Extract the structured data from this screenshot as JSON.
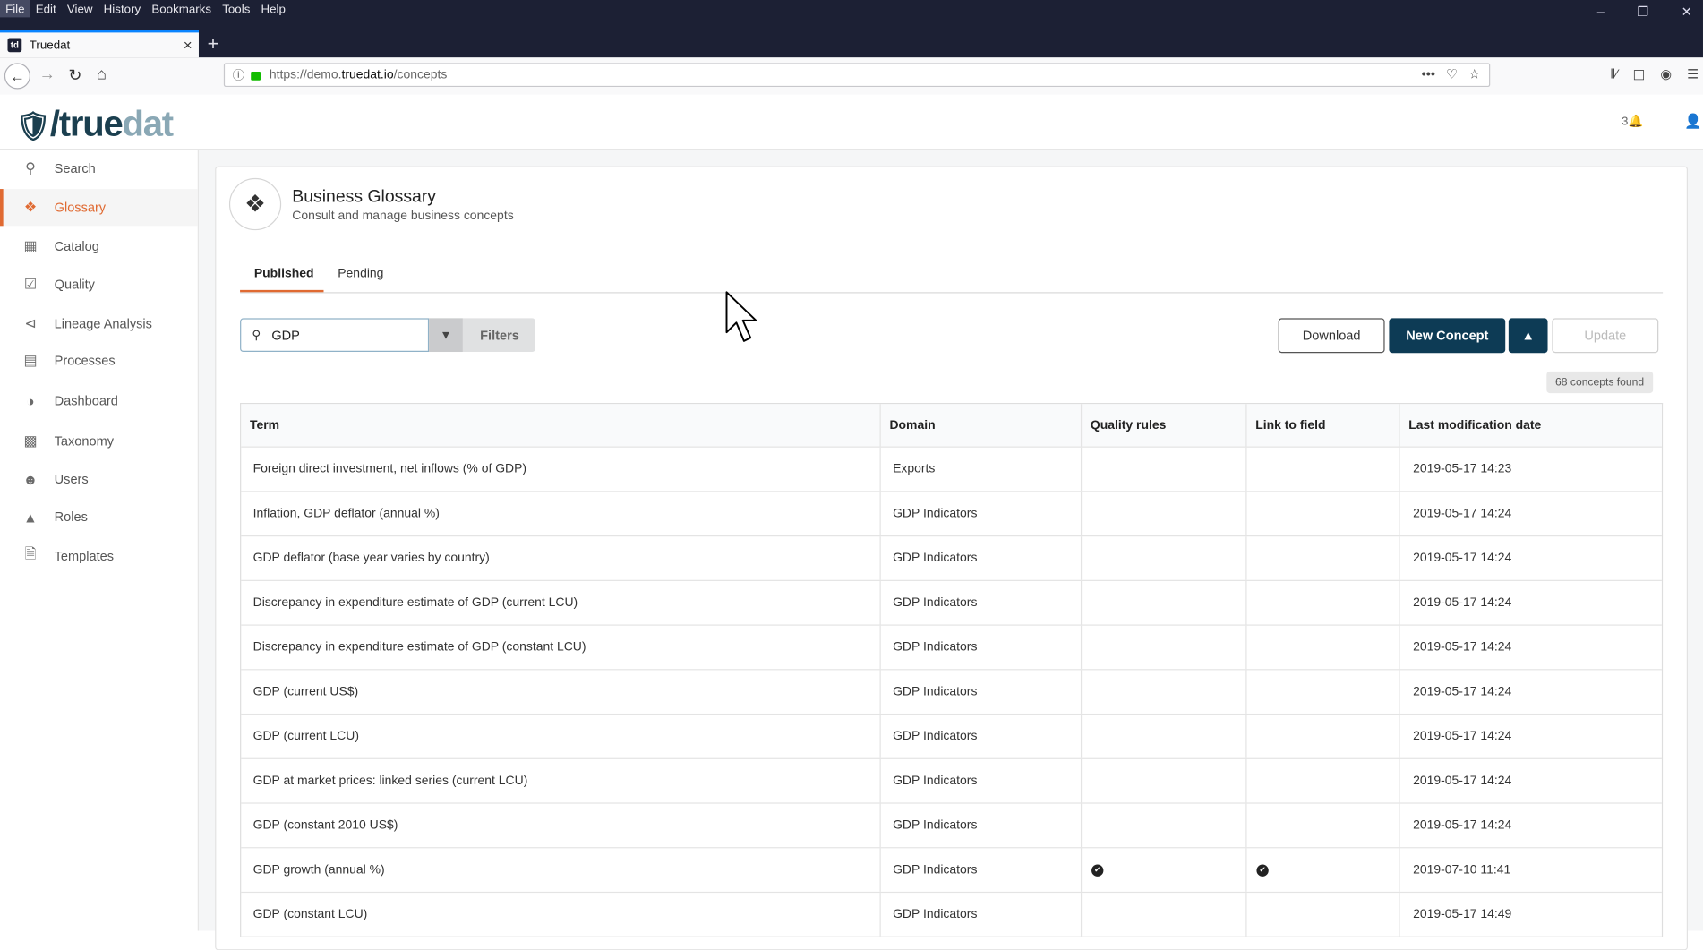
{
  "browser": {
    "menu": [
      "File",
      "Edit",
      "View",
      "History",
      "Bookmarks",
      "Tools",
      "Help"
    ],
    "tab_title": "Truedat",
    "favicon_text": "td",
    "url_prefix": "https://demo.",
    "url_domain": "truedat.io",
    "url_path": "/concepts"
  },
  "app": {
    "logo_main": "/true",
    "logo_accent": "dat",
    "notifications": "3"
  },
  "sidebar": {
    "items": [
      {
        "label": "Search",
        "icon": "search-icon"
      },
      {
        "label": "Glossary",
        "icon": "tags-icon"
      },
      {
        "label": "Catalog",
        "icon": "grid-icon"
      },
      {
        "label": "Quality",
        "icon": "checkbox-icon"
      },
      {
        "label": "Lineage Analysis",
        "icon": "share-icon"
      },
      {
        "label": "Processes",
        "icon": "drive-icon"
      },
      {
        "label": "Dashboard",
        "icon": "gauge-icon"
      },
      {
        "label": "Taxonomy",
        "icon": "sitemap-icon"
      },
      {
        "label": "Users",
        "icon": "users-icon"
      },
      {
        "label": "Roles",
        "icon": "graduation-icon"
      },
      {
        "label": "Templates",
        "icon": "file-code-icon"
      }
    ]
  },
  "page": {
    "title": "Business Glossary",
    "subtitle": "Consult and manage business concepts",
    "tabs": [
      "Published",
      "Pending"
    ],
    "search_value": "GDP",
    "filters_label": "Filters",
    "download_label": "Download",
    "new_concept_label": "New Concept",
    "update_label": "Update",
    "found_label": "68 concepts found"
  },
  "table": {
    "headers": [
      "Term",
      "Domain",
      "Quality rules",
      "Link to field",
      "Last modification date"
    ],
    "rows": [
      {
        "term": "Foreign direct investment, net inflows (% of GDP)",
        "domain": "Exports",
        "quality": false,
        "link": false,
        "date": "2019-05-17 14:23"
      },
      {
        "term": "Inflation, GDP deflator (annual %)",
        "domain": "GDP Indicators",
        "quality": false,
        "link": false,
        "date": "2019-05-17 14:24"
      },
      {
        "term": "GDP deflator (base year varies by country)",
        "domain": "GDP Indicators",
        "quality": false,
        "link": false,
        "date": "2019-05-17 14:24"
      },
      {
        "term": "Discrepancy in expenditure estimate of GDP (current LCU)",
        "domain": "GDP Indicators",
        "quality": false,
        "link": false,
        "date": "2019-05-17 14:24"
      },
      {
        "term": "Discrepancy in expenditure estimate of GDP (constant LCU)",
        "domain": "GDP Indicators",
        "quality": false,
        "link": false,
        "date": "2019-05-17 14:24"
      },
      {
        "term": "GDP (current US$)",
        "domain": "GDP Indicators",
        "quality": false,
        "link": false,
        "date": "2019-05-17 14:24"
      },
      {
        "term": "GDP (current LCU)",
        "domain": "GDP Indicators",
        "quality": false,
        "link": false,
        "date": "2019-05-17 14:24"
      },
      {
        "term": "GDP at market prices: linked series (current LCU)",
        "domain": "GDP Indicators",
        "quality": false,
        "link": false,
        "date": "2019-05-17 14:24"
      },
      {
        "term": "GDP (constant 2010 US$)",
        "domain": "GDP Indicators",
        "quality": false,
        "link": false,
        "date": "2019-05-17 14:24"
      },
      {
        "term": "GDP growth (annual %)",
        "domain": "GDP Indicators",
        "quality": true,
        "link": true,
        "date": "2019-07-10 11:41"
      },
      {
        "term": "GDP (constant LCU)",
        "domain": "GDP Indicators",
        "quality": false,
        "link": false,
        "date": "2019-05-17 14:49"
      }
    ]
  },
  "colors": {
    "accent": "#e06a32",
    "primary": "#0d3b55",
    "browser_chrome": "#1c2034"
  }
}
